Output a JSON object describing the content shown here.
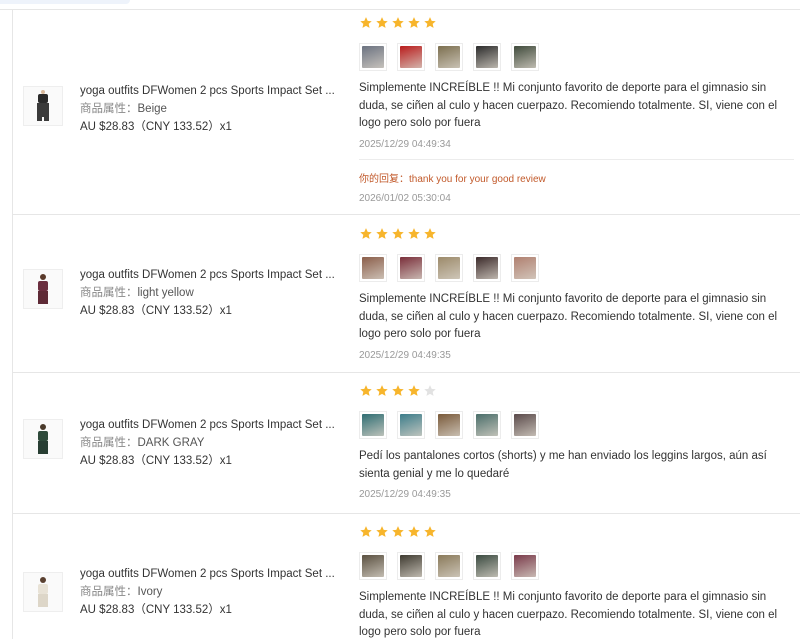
{
  "colors": {
    "star_on": "#f7b52c",
    "star_off": "#e2e2e2",
    "reply": "#c25a2b",
    "muted": "#999999",
    "border": "#e6e6e6"
  },
  "icons": {
    "star": "star-icon",
    "product": "product-thumbnail"
  },
  "attr_label": "商品属性：",
  "reviews": [
    {
      "product_title": "yoga outfits DFWomen 2 pcs Sports Impact Set ...",
      "attr_value": "Beige",
      "price": "AU $28.83（CNY  133.52）x1",
      "rating": 5,
      "image_tones": [
        "#6b7280",
        "#b91c1c",
        "#7c6f4f",
        "#2b2b2b",
        "#3f4a3b"
      ],
      "text": "Simplemente INCREÍBLE !! Mi conjunto favorito de deporte para el gimnasio sin duda, se ciñen al culo y hacen cuerpazo. Recomiendo totalmente. SI, viene con el logo pero solo por fuera",
      "time": "2025/12/29 04:49:34",
      "reply": "你的回复：thank you for your good review",
      "reply_time": "2026/01/02 05:30:04"
    },
    {
      "product_title": "yoga outfits DFWomen 2 pcs Sports Impact Set ...",
      "attr_value": "light yellow",
      "price": "AU $28.83（CNY  133.52）x1",
      "rating": 5,
      "image_tones": [
        "#8b5e4a",
        "#7a2e3a",
        "#9c8a6a",
        "#3b2a2a",
        "#b08070"
      ],
      "text": "Simplemente INCREÍBLE !! Mi conjunto favorito de deporte para el gimnasio sin duda, se ciñen al culo y hacen cuerpazo. Recomiendo totalmente. SI, viene con el logo pero solo por fuera",
      "time": "2025/12/29 04:49:35"
    },
    {
      "product_title": "yoga outfits DFWomen 2 pcs Sports Impact Set ...",
      "attr_value": "DARK GRAY",
      "price": "AU $28.83（CNY  133.52）x1",
      "rating": 4,
      "image_tones": [
        "#2f6e73",
        "#3c7d8a",
        "#7a5a3a",
        "#4a6e6a",
        "#5a4a4a"
      ],
      "text": "Pedí los pantalones cortos (shorts) y me han enviado los leggins largos, aún así sienta genial y me lo quedaré",
      "time": "2025/12/29 04:49:35"
    },
    {
      "product_title": "yoga outfits DFWomen 2 pcs Sports Impact Set ...",
      "attr_value": "Ivory",
      "price": "AU $28.83（CNY  133.52）x1",
      "rating": 5,
      "image_tones": [
        "#5a5040",
        "#3e3a30",
        "#8a7a5a",
        "#3a4a40",
        "#7a3a4a"
      ],
      "text": "Simplemente INCREÍBLE !! Mi conjunto favorito de deporte para el gimnasio sin duda, se ciñen al culo y hacen cuerpazo. Recomiendo totalmente. SI, viene con el logo pero solo por fuera"
    }
  ]
}
